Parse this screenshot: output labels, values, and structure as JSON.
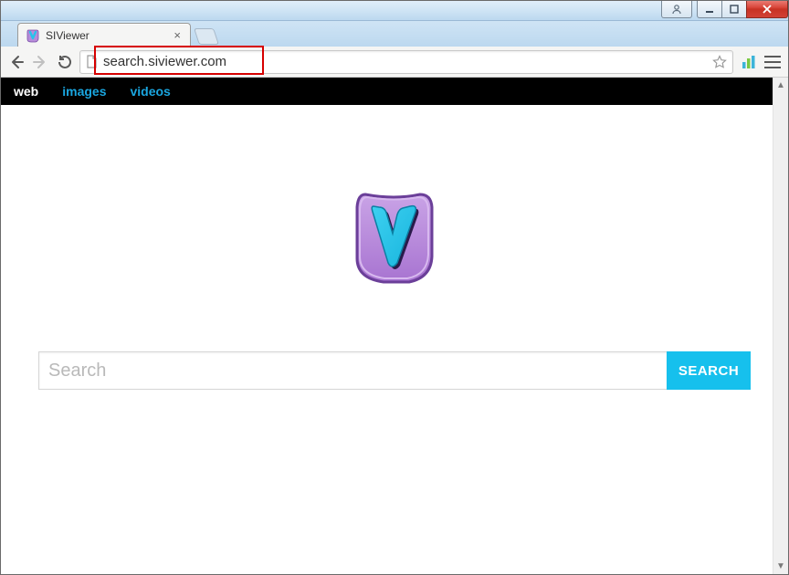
{
  "window": {
    "user_button": "",
    "min_button": "",
    "max_button": "",
    "close_button": ""
  },
  "browser": {
    "tab_title": "SIViewer",
    "url": "search.siviewer.com",
    "nav_tabs": [
      {
        "label": "web",
        "active": true
      },
      {
        "label": "images",
        "active": false
      },
      {
        "label": "videos",
        "active": false
      }
    ]
  },
  "search": {
    "placeholder": "Search",
    "button_label": "SEARCH",
    "value": ""
  },
  "icons": {
    "back": "back-arrow-icon",
    "forward": "forward-arrow-icon",
    "reload": "reload-icon",
    "page": "page-icon",
    "star": "star-icon",
    "extension": "bar-chart-icon",
    "menu": "hamburger-menu-icon",
    "tab_close": "close-icon",
    "user": "user-icon",
    "window_min": "minimize-icon",
    "window_max": "maximize-icon",
    "window_close": "close-icon",
    "newtab": "new-tab-icon"
  },
  "colors": {
    "accent_cyan": "#16c0ed",
    "nav_link": "#1aa6e0",
    "highlight": "#d60000",
    "logo_purple": "#b78cd9",
    "logo_purple_dark": "#7a4fa8",
    "logo_cyan": "#27c3ea"
  }
}
